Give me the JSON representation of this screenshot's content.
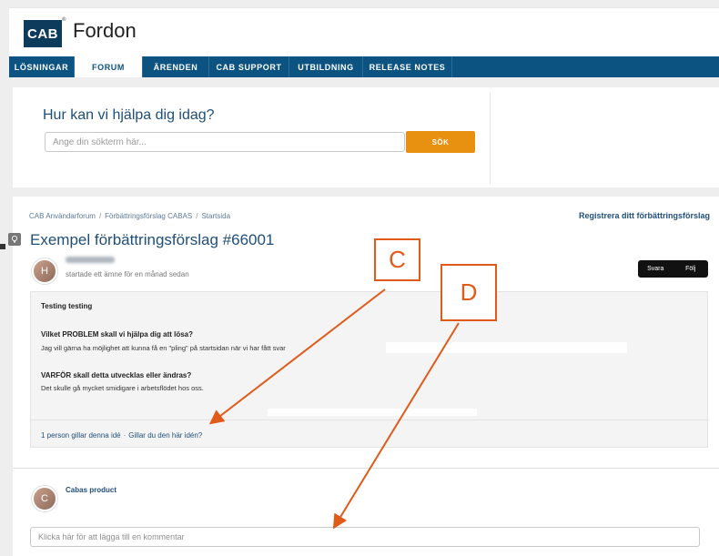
{
  "header": {
    "logo_text": "CAB",
    "logo_mark": "®",
    "brand": "Fordon"
  },
  "nav": {
    "items": [
      {
        "label": "LÖSNINGAR",
        "active": false
      },
      {
        "label": "FORUM",
        "active": true
      },
      {
        "label": "ÄRENDEN",
        "active": false
      },
      {
        "label": "CAB SUPPORT",
        "active": false
      },
      {
        "label": "UTBILDNING",
        "active": false
      },
      {
        "label": "RELEASE NOTES",
        "active": false
      }
    ]
  },
  "search": {
    "title": "Hur kan vi hjälpa dig idag?",
    "placeholder": "Ange din sökterm här...",
    "button_label": "SÖK"
  },
  "breadcrumb": {
    "items": [
      "CAB Användarforum",
      "Förbättringsförslag CABAS",
      "Startsida"
    ],
    "separator": "/"
  },
  "register_link": "Registrera ditt förbättringsförslag",
  "post": {
    "title": "Exempel förbättringsförslag #66001",
    "author_initial": "H",
    "meta": "startade ett ämne för en månad sedan",
    "reply_label": "Svara",
    "follow_label": "Följ",
    "intro": "Testing testing",
    "problem_heading": "Vilket PROBLEM skall vi hjälpa dig att lösa?",
    "problem_text": "Jag vill gärna ha möjlighet att kunna få en \"pling\" på startsidan när vi har fått svar",
    "why_heading": "VARFÖR skall detta utvecklas eller ändras?",
    "why_text": "Det skulle gå mycket smidigare i arbetsflödet hos oss.",
    "likes_text": "1 person gillar denna idé",
    "likes_separator": "·",
    "likes_question": "Gillar du den här idén?"
  },
  "comment": {
    "author_initial": "C",
    "author_name": "Cabas product",
    "placeholder": "Klicka här för att lägga till en kommentar"
  },
  "annotations": {
    "c_label": "C",
    "d_label": "D",
    "color": "#e05a1a"
  },
  "colors": {
    "nav_bg": "#0c5382",
    "brand_blue": "#1f4e79",
    "search_button": "#e8900f",
    "logo_bg": "#0d3b5c"
  },
  "icons": {
    "idea": "lightbulb-icon"
  }
}
